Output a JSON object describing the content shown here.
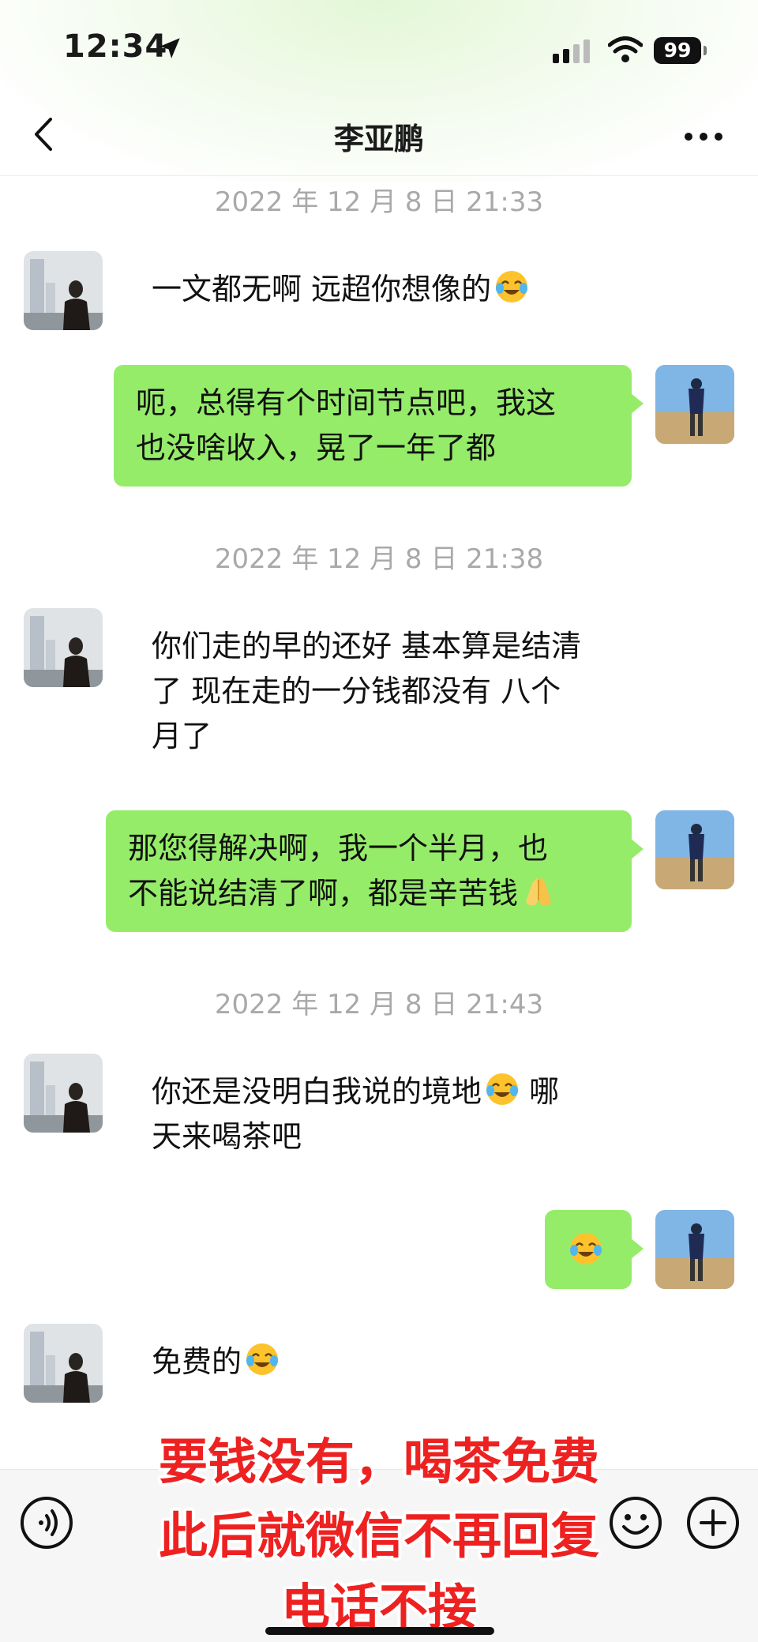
{
  "status_bar": {
    "time": "12:34",
    "battery": "99"
  },
  "nav": {
    "title": "李亚鹏"
  },
  "messages": [
    {
      "type": "time",
      "text": "2022 年 12 月 8 日 21:33"
    },
    {
      "type": "in",
      "text": "一文都无啊 远超你想像的",
      "emoji": "crying-laughing-emoji"
    },
    {
      "type": "out",
      "line1": "呃，总得有个时间节点吧，我这",
      "line2": "也没啥收入，晃了一年了都"
    },
    {
      "type": "time",
      "text": "2022 年 12 月 8 日 21:38"
    },
    {
      "type": "in",
      "line1": "你们走的早的还好 基本算是结清",
      "line2": "了 现在走的一分钱都没有 八个",
      "line3": "月了"
    },
    {
      "type": "out",
      "line1": "那您得解决啊，我一个半月，也",
      "line2": "不能说结清了啊，都是辛苦钱",
      "emoji": "praying-hands-emoji"
    },
    {
      "type": "time",
      "text": "2022 年 12 月 8 日 21:43"
    },
    {
      "type": "in",
      "line1": "你还是没明白我说的境地",
      "line1_tail": " 哪",
      "line2": "天来喝茶吧",
      "emoji": "crying-laughing-emoji"
    },
    {
      "type": "out",
      "emoji": "crying-laughing-emoji"
    },
    {
      "type": "in",
      "text": "免费的",
      "emoji": "crying-laughing-emoji"
    }
  ],
  "overlay_caption": {
    "line1": "要钱没有，喝茶免费",
    "line2": "此后就微信不再回复",
    "line3": "电话不接"
  },
  "colors": {
    "bubble_out": "#95ec69",
    "timestamp": "#a9a9a9",
    "caption": "#ee2121"
  }
}
